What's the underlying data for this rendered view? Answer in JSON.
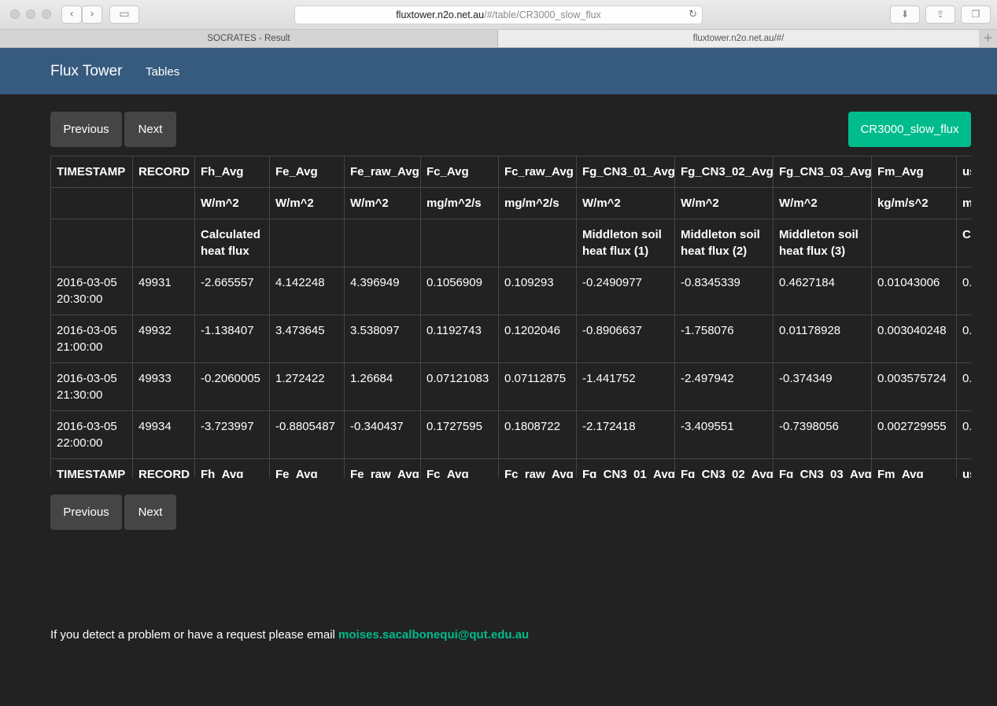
{
  "browser": {
    "url_host": "fluxtower.n2o.net.au",
    "url_path": "/#/table/CR3000_slow_flux",
    "tabs": [
      {
        "label": "SOCRATES - Result"
      },
      {
        "label": "fluxtower.n2o.net.au/#/"
      }
    ]
  },
  "navbar": {
    "brand": "Flux Tower",
    "links": [
      {
        "label": "Tables"
      }
    ]
  },
  "pager": {
    "previous": "Previous",
    "next": "Next"
  },
  "table_name_button": "CR3000_slow_flux",
  "table": {
    "columns": [
      "TIMESTAMP",
      "RECORD",
      "Fh_Avg",
      "Fe_Avg",
      "Fe_raw_Avg",
      "Fc_Avg",
      "Fc_raw_Avg",
      "Fg_CN3_01_Avg",
      "Fg_CN3_02_Avg",
      "Fg_CN3_03_Avg",
      "Fm_Avg",
      "us"
    ],
    "units": [
      "",
      "",
      "W/m^2",
      "W/m^2",
      "W/m^2",
      "mg/m^2/s",
      "mg/m^2/s",
      "W/m^2",
      "W/m^2",
      "W/m^2",
      "kg/m/s^2",
      "m"
    ],
    "descriptions": [
      "",
      "",
      "Calculated heat flux",
      "",
      "",
      "",
      "",
      "Middleton soil heat flux (1)",
      "Middleton soil heat flux (2)",
      "Middleton soil heat flux (3)",
      "",
      "C U"
    ],
    "rows": [
      [
        "2016-03-05 20:30:00",
        "49931",
        "-2.665557",
        "4.142248",
        "4.396949",
        "0.1056909",
        "0.109293",
        "-0.2490977",
        "-0.8345339",
        "0.4627184",
        "0.01043006",
        "0."
      ],
      [
        "2016-03-05 21:00:00",
        "49932",
        "-1.138407",
        "3.473645",
        "3.538097",
        "0.1192743",
        "0.1202046",
        "-0.8906637",
        "-1.758076",
        "0.01178928",
        "0.003040248",
        "0."
      ],
      [
        "2016-03-05 21:30:00",
        "49933",
        "-0.2060005",
        "1.272422",
        "1.26684",
        "0.07121083",
        "0.07112875",
        "-1.441752",
        "-2.497942",
        "-0.374349",
        "0.003575724",
        "0."
      ],
      [
        "2016-03-05 22:00:00",
        "49934",
        "-3.723997",
        "-0.8805487",
        "-0.340437",
        "0.1727595",
        "0.1808722",
        "-2.172418",
        "-3.409551",
        "-0.7398056",
        "0.002729955",
        "0."
      ]
    ]
  },
  "footer": {
    "text": "If you detect a problem or have a request please email ",
    "email": "moises.sacalbonequi@qut.edu.au"
  },
  "colors": {
    "navbar": "#375a7f",
    "background": "#222222",
    "accent": "#00bc8c",
    "button": "#464545"
  }
}
